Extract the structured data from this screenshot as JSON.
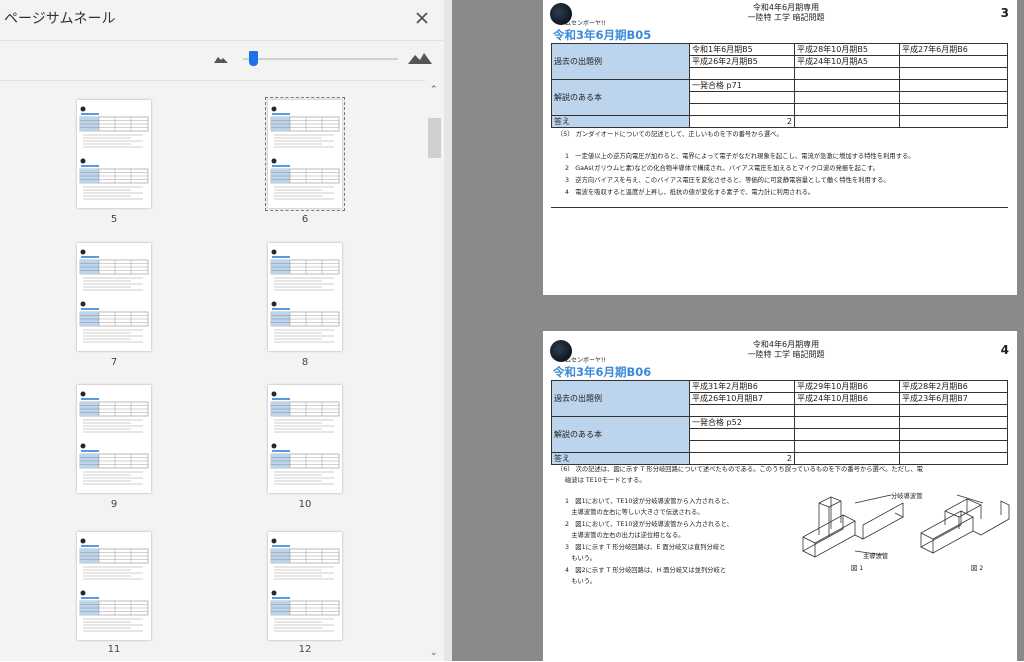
{
  "panel": {
    "title": "ページサムネール",
    "selected_page": "6",
    "thumbnails": [
      {
        "label": "5"
      },
      {
        "label": "6"
      },
      {
        "label": "7"
      },
      {
        "label": "8"
      },
      {
        "label": "9"
      },
      {
        "label": "10"
      },
      {
        "label": "11"
      },
      {
        "label": "12"
      }
    ]
  },
  "icons": {
    "close": "close-icon",
    "zoom_small": "small-mountain-icon",
    "zoom_large": "large-mountain-icon",
    "collapse": "chevron-left-icon"
  },
  "colors": {
    "accent": "#1a73e8",
    "title_blue": "#3a8ad8",
    "label_cell": "#bcd4ec",
    "viewer_bg": "#8a8a8a"
  },
  "page3": {
    "logo_text": "ムセンボーヤ!!",
    "header_line1": "令和4年6月期専用",
    "header_line2": "一陸特 工学 暗記問題",
    "page_number": "3",
    "title": "令和3年6月期B05",
    "rows": {
      "past_label": "過去の出題例",
      "past": [
        [
          "令和1年6月期B5",
          "平成28年10月期B5",
          "平成27年6月期B6"
        ],
        [
          "平成26年2月期B5",
          "平成24年10月期A5",
          ""
        ]
      ],
      "book_label": "解説のある本",
      "book": "一発合格 p71",
      "answer_label": "答え",
      "answer": "2"
    },
    "question": "〔5〕 ガンダイオードについての記述として、正しいものを下の番号から選べ。",
    "options": [
      "1　一定値以上の逆方向電圧が加わると、電界によって電子がなだれ現象を起こし、電流が急激に増加する特性を利用する。",
      "2　GaAs(ガリウムヒ素)などの化合物半導体で構成され、バイアス電圧を加えるとマイクロ波の発振を起こす。",
      "3　逆方向バイアスを与え、このバイアス電圧を変化させると、等価的に可変静電容量として働く特性を利用する。",
      "4　電波を吸収すると温度が上昇し、抵抗の値が変化する素子で、電力計に利用される。"
    ]
  },
  "page4": {
    "logo_text": "ムセンボーヤ!!",
    "header_line1": "令和4年6月期専用",
    "header_line2": "一陸特 工学 暗記問題",
    "page_number": "4",
    "title": "令和3年6月期B06",
    "rows": {
      "past_label": "過去の出題例",
      "past": [
        [
          "平成31年2月期B6",
          "平成29年10月期B6",
          "平成28年2月期B6"
        ],
        [
          "平成26年10月期B7",
          "平成24年10月期B6",
          "平成23年6月期B7"
        ]
      ],
      "book_label": "解説のある本",
      "book": "一発合格 p52",
      "answer_label": "答え",
      "answer": "2"
    },
    "question_line1": "〔6〕 次の記述は、図に示す T 形分岐回路について述べたものである。このうち誤っているものを下の番号から選べ。ただし、電",
    "question_line2": "磁波は TE10モードとする。",
    "options": [
      "1　図1において、TE10波が分岐導波管から入力されると、",
      "　主導波管の左右に等しい大きさで伝送される。",
      "2　図1において、TE10波が分岐導波管から入力されると、",
      "　主導波管の左右の出力は逆位相となる。",
      "3　図1に示す T 形分岐回路は、E 面分岐又は直列分岐と",
      "　もいう。",
      "4　図2に示す T 形分岐回路は、H 面分岐又は並列分岐と",
      "　もいう。"
    ],
    "figure": {
      "branch_label": "分岐導波管",
      "main_label": "主導波管",
      "fig1": "図 1",
      "fig2": "図 2"
    }
  }
}
